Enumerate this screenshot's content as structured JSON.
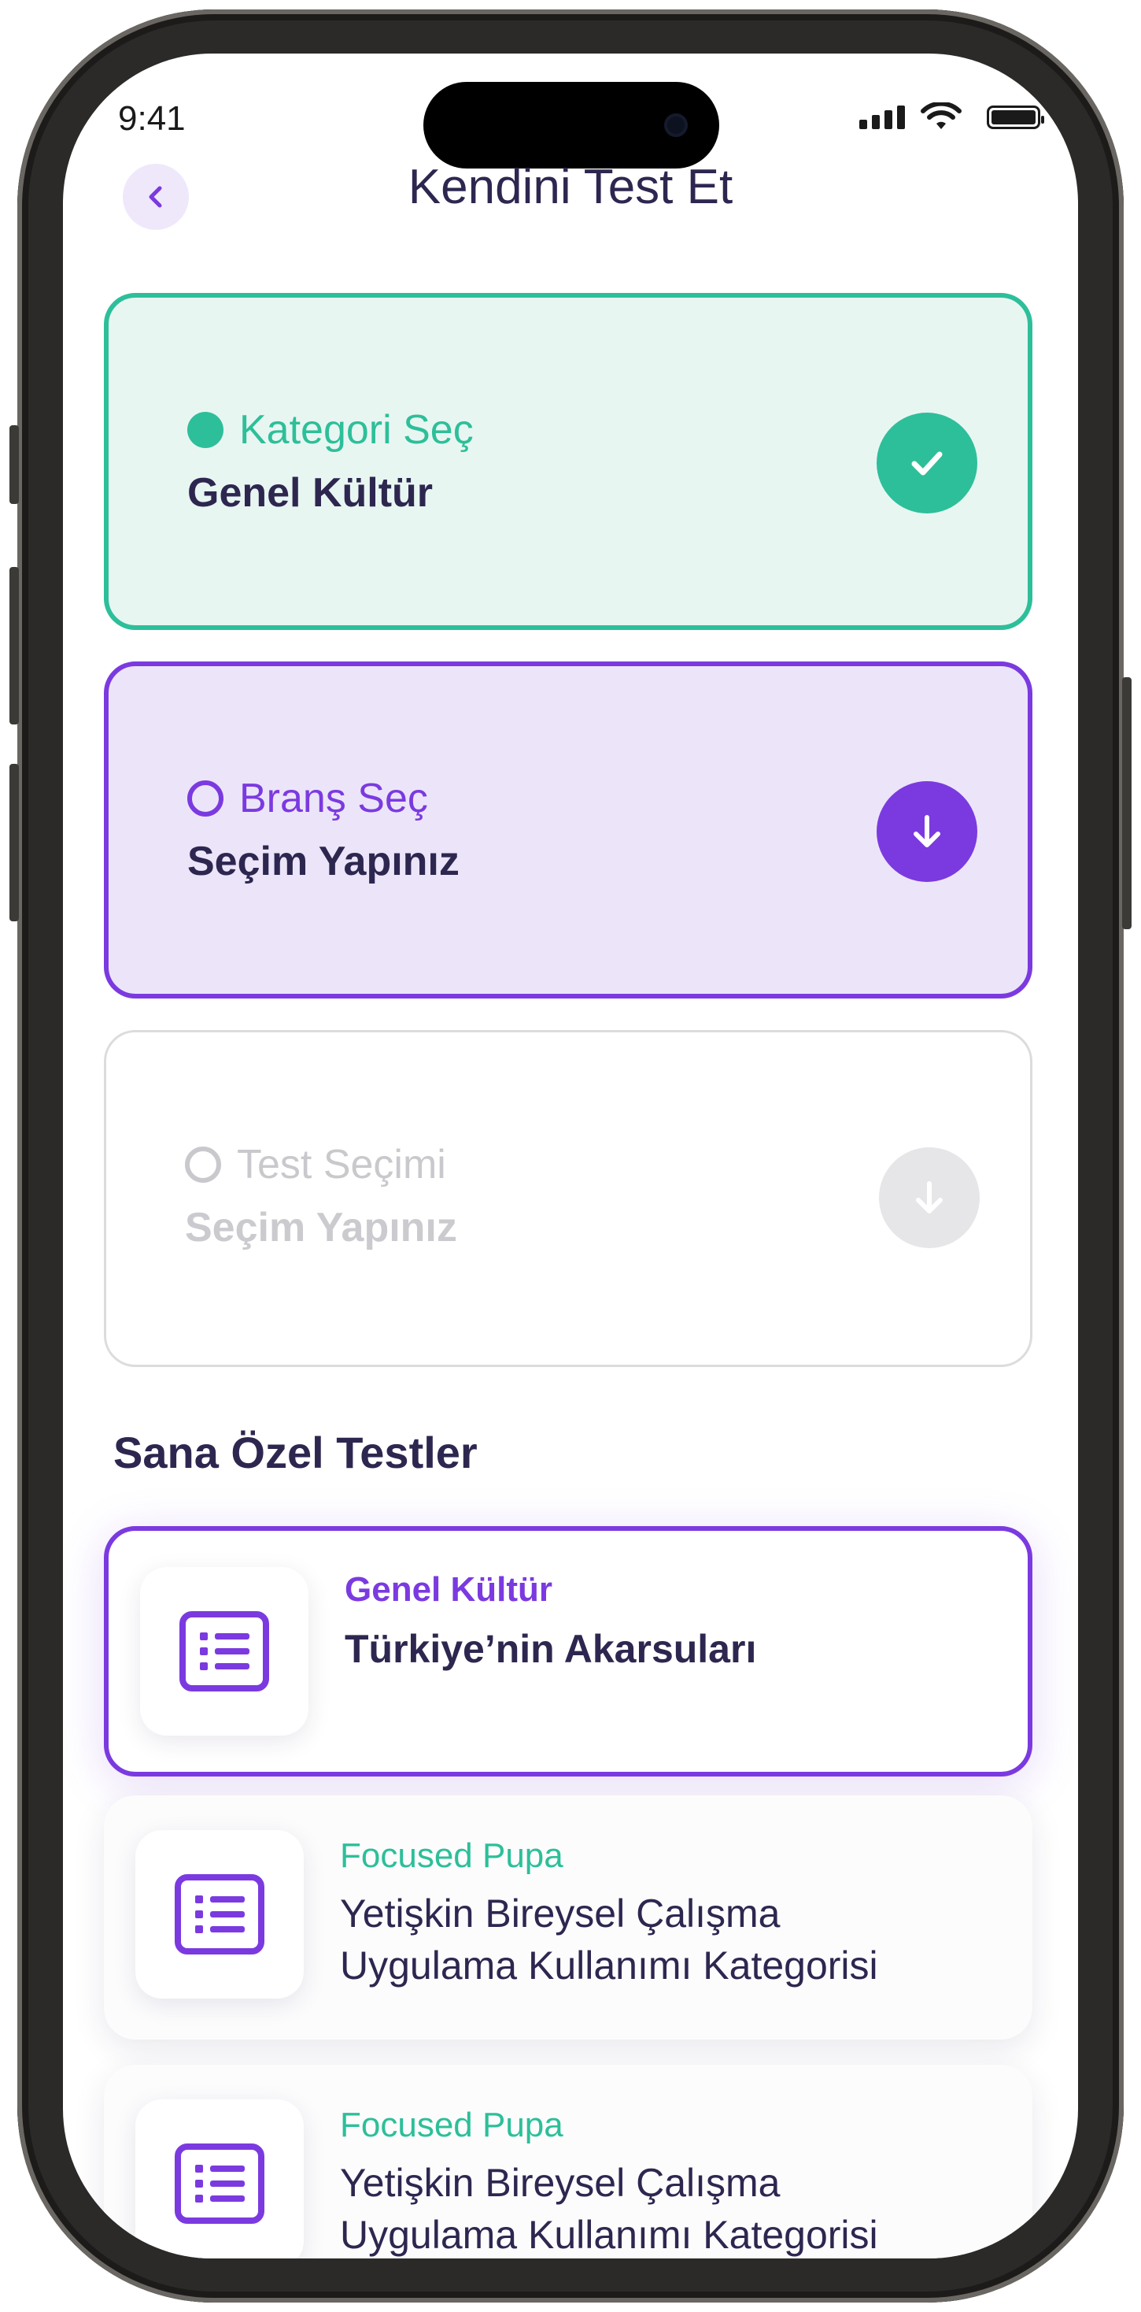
{
  "status_bar": {
    "time": "9:41"
  },
  "header": {
    "title": "Kendini Test Et",
    "back_icon": "chevron-left-icon"
  },
  "steps": [
    {
      "label": "Kategori Seç",
      "value": "Genel Kültür",
      "state": "completed",
      "action_icon": "check-icon"
    },
    {
      "label": "Branş Seç",
      "value": "Seçim Yapınız",
      "state": "active",
      "action_icon": "arrow-down-icon"
    },
    {
      "label": "Test Seçimi",
      "value": "Seçim Yapınız",
      "state": "disabled",
      "action_icon": "arrow-down-icon"
    }
  ],
  "section": {
    "title": "Sana Özel Testler"
  },
  "tests": [
    {
      "category": "Genel Kültür",
      "title": "Türkiye’nin Akarsuları",
      "highlighted": true,
      "icon": "list-icon"
    },
    {
      "category": "Focused Pupa",
      "title_line1": "Yetişkin Bireysel Çalışma",
      "title_line2": "Uygulama Kullanımı Kategorisi",
      "icon": "list-icon"
    },
    {
      "category": "Focused Pupa",
      "title_line1": "Yetişkin Bireysel Çalışma",
      "title_line2": "Uygulama Kullanımı Kategorisi",
      "icon": "list-icon"
    }
  ],
  "colors": {
    "primary": "#7b3ae0",
    "success": "#2dbf99",
    "text_dark": "#2d2750",
    "disabled": "#c9c9cd"
  }
}
